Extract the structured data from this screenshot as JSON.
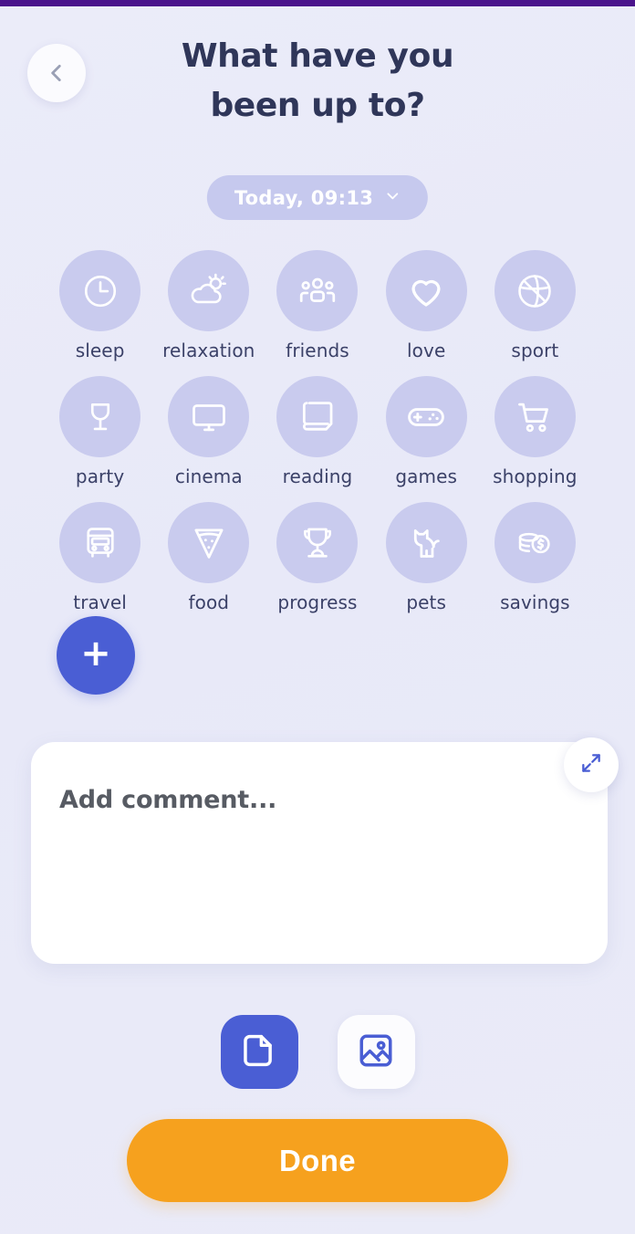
{
  "header": {
    "title_line1": "What have you",
    "title_line2": "been up to?",
    "back_icon": "chevron-left-icon"
  },
  "date_selector": {
    "label": "Today, 09:13",
    "chevron_icon": "chevron-down-icon"
  },
  "activities": [
    {
      "label": "sleep",
      "icon": "clock-icon"
    },
    {
      "label": "relaxation",
      "icon": "sun-cloud-icon"
    },
    {
      "label": "friends",
      "icon": "people-group-icon"
    },
    {
      "label": "love",
      "icon": "heart-icon"
    },
    {
      "label": "sport",
      "icon": "basketball-icon"
    },
    {
      "label": "party",
      "icon": "wine-glass-icon"
    },
    {
      "label": "cinema",
      "icon": "monitor-icon"
    },
    {
      "label": "reading",
      "icon": "book-icon"
    },
    {
      "label": "games",
      "icon": "gamepad-icon"
    },
    {
      "label": "shopping",
      "icon": "shopping-cart-icon"
    },
    {
      "label": "travel",
      "icon": "bus-icon"
    },
    {
      "label": "food",
      "icon": "pizza-slice-icon"
    },
    {
      "label": "progress",
      "icon": "trophy-icon"
    },
    {
      "label": "pets",
      "icon": "cat-icon"
    },
    {
      "label": "savings",
      "icon": "coins-dollar-icon"
    }
  ],
  "add_activity": {
    "label": "+",
    "icon": "plus-icon"
  },
  "comment": {
    "placeholder": "Add comment...",
    "value": "",
    "expand_icon": "expand-arrows-icon"
  },
  "attachments": [
    {
      "icon": "file-document-icon",
      "state": "active"
    },
    {
      "icon": "image-photo-icon",
      "state": "inactive"
    }
  ],
  "done_button": {
    "label": "Done"
  },
  "colors": {
    "background": "#e8e9f8",
    "status_strip": "#4a148c",
    "circle": "#c9cbee",
    "pill": "#c6c9ee",
    "accent_blue": "#4a5ed4",
    "accent_orange": "#f6a11e",
    "title_text": "#2f3659",
    "label_text": "#3b4168",
    "card_white": "#ffffff"
  }
}
